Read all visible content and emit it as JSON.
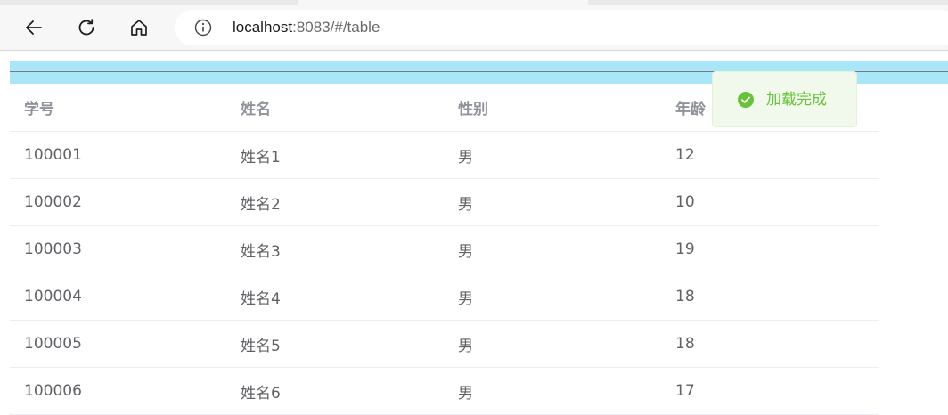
{
  "browser": {
    "url_host": "localhost",
    "url_rest": ":8083/#/table"
  },
  "table": {
    "headers": [
      "学号",
      "姓名",
      "性别",
      "年龄"
    ],
    "rows": [
      [
        "100001",
        "姓名1",
        "男",
        "12"
      ],
      [
        "100002",
        "姓名2",
        "男",
        "10"
      ],
      [
        "100003",
        "姓名3",
        "男",
        "19"
      ],
      [
        "100004",
        "姓名4",
        "男",
        "18"
      ],
      [
        "100005",
        "姓名5",
        "男",
        "18"
      ],
      [
        "100006",
        "姓名6",
        "男",
        "17"
      ]
    ]
  },
  "toast": {
    "message": "加载完成",
    "type": "success",
    "color": "#67c23a"
  },
  "colors": {
    "banner": "#a8e6f8"
  }
}
